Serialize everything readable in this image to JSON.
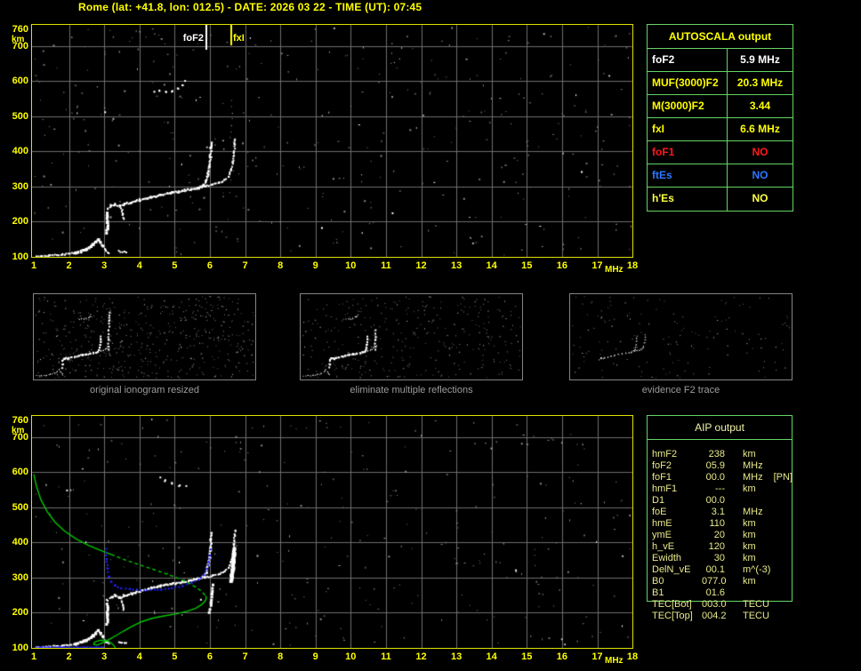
{
  "title": "Rome (lat: +41.8, lon: 012.5) - DATE: 2026 03 22 - TIME (UT): 07:45",
  "colors": {
    "background": "#000000",
    "accent_yellow": "#ffff00",
    "plot_border": "#e0e000",
    "grid": "#6e6e6e",
    "table_border": "#63d563",
    "trace_white": "#ffffff",
    "profile_green": "#00c800",
    "model_blue": "#2222ff",
    "red": "#ff1a1a",
    "blue": "#2d77ff",
    "aip_text": "#e9e98c",
    "caption_gray": "#9c9c9c"
  },
  "autoscala": {
    "header": "AUTOSCALA output",
    "rows": [
      {
        "label": "foF2",
        "value": "5.9 MHz",
        "color": "#ffffff"
      },
      {
        "label": "MUF(3000)F2",
        "value": "20.3 MHz",
        "color": "#ffff00"
      },
      {
        "label": "M(3000)F2",
        "value": "3.44",
        "color": "#ffff00"
      },
      {
        "label": "fxI",
        "value": "6.6 MHz",
        "color": "#ffff00"
      },
      {
        "label": "foF1",
        "value": "NO",
        "color": "#ff1a1a"
      },
      {
        "label": "ftEs",
        "value": "NO",
        "color": "#2d77ff"
      },
      {
        "label": "h'Es",
        "value": "NO",
        "color": "#ffff44"
      }
    ]
  },
  "aip": {
    "header": "AIP output",
    "rows": [
      {
        "label": "hmF2",
        "value": "238",
        "unit": "km",
        "note": ""
      },
      {
        "label": "foF2",
        "value": "05.9",
        "unit": "MHz",
        "note": ""
      },
      {
        "label": "foF1",
        "value": "00.0",
        "unit": "MHz",
        "note": "[PN]"
      },
      {
        "label": "hmF1",
        "value": "---",
        "unit": "km",
        "note": ""
      },
      {
        "label": "D1",
        "value": "00.0",
        "unit": "",
        "note": ""
      },
      {
        "label": "foE",
        "value": "3.1",
        "unit": "MHz",
        "note": ""
      },
      {
        "label": "hmE",
        "value": "110",
        "unit": "km",
        "note": ""
      },
      {
        "label": "ymE",
        "value": "20",
        "unit": "km",
        "note": ""
      },
      {
        "label": "h_vE",
        "value": "120",
        "unit": "km",
        "note": ""
      },
      {
        "label": "Ewidth",
        "value": "30",
        "unit": "km",
        "note": ""
      },
      {
        "label": "DelN_vE",
        "value": "00.1",
        "unit": "m^(-3)",
        "note": ""
      },
      {
        "label": "B0",
        "value": "077.0",
        "unit": "km",
        "note": ""
      },
      {
        "label": "B1",
        "value": "01.6",
        "unit": "",
        "note": ""
      },
      {
        "label": "TEC[Bot]",
        "value": "003.0",
        "unit": "TECU",
        "note": ""
      },
      {
        "label": "TEC[Top]",
        "value": "004.2",
        "unit": "TECU",
        "note": ""
      }
    ]
  },
  "thumbnails": [
    {
      "caption": "original ionogram resized"
    },
    {
      "caption": "eliminate multiple reflections"
    },
    {
      "caption": "evidence F2 trace"
    }
  ],
  "chart_data": {
    "type": "scatter",
    "x_axis": {
      "label": "MHz",
      "range": [
        1,
        18
      ],
      "ticks": [
        "1",
        "2",
        "3",
        "4",
        "5",
        "6",
        "7",
        "8",
        "9",
        "10",
        "11",
        "12",
        "13",
        "14",
        "15",
        "16",
        "17",
        "18"
      ]
    },
    "y_axis": {
      "label": "km",
      "range": [
        100,
        760
      ],
      "ticks": [
        "760",
        "700",
        "600",
        "500",
        "400",
        "300",
        "200",
        "100"
      ]
    },
    "markers": {
      "foF2": {
        "label": "foF2",
        "freq": 5.9,
        "color": "#ffffff"
      },
      "fxI": {
        "label": "fxI",
        "freq": 6.6,
        "color": "#ffff00"
      }
    },
    "traces": {
      "e_layer": [
        [
          1.05,
          104
        ],
        [
          1.4,
          106
        ],
        [
          1.8,
          109
        ],
        [
          2.15,
          114
        ],
        [
          2.45,
          124
        ],
        [
          2.65,
          138
        ],
        [
          2.8,
          152
        ],
        [
          2.92,
          136
        ],
        [
          3.02,
          120
        ],
        [
          3.1,
          113
        ]
      ],
      "e_tail": [
        [
          3.38,
          118
        ],
        [
          3.6,
          115
        ]
      ],
      "cusp_cluster": [
        [
          3.04,
          172
        ],
        [
          3.06,
          200
        ],
        [
          3.05,
          228
        ]
      ],
      "f_trace": [
        [
          3.07,
          238
        ],
        [
          3.18,
          248
        ],
        [
          3.3,
          251
        ],
        [
          3.42,
          246
        ],
        [
          3.55,
          251
        ],
        [
          3.75,
          257
        ],
        [
          4.0,
          264
        ],
        [
          4.3,
          272
        ],
        [
          4.6,
          279
        ],
        [
          4.9,
          285
        ],
        [
          5.2,
          290
        ],
        [
          5.45,
          294
        ],
        [
          5.65,
          299
        ],
        [
          5.8,
          306
        ],
        [
          5.88,
          318
        ],
        [
          5.93,
          338
        ],
        [
          5.96,
          360
        ],
        [
          5.99,
          385
        ],
        [
          6.01,
          410
        ],
        [
          6.02,
          428
        ]
      ],
      "f_spur": [
        [
          3.46,
          242
        ],
        [
          3.5,
          226
        ],
        [
          3.53,
          210
        ]
      ],
      "x_trace": [
        [
          5.62,
          297
        ],
        [
          5.85,
          303
        ],
        [
          6.05,
          308
        ],
        [
          6.25,
          313
        ],
        [
          6.4,
          320
        ],
        [
          6.5,
          331
        ],
        [
          6.58,
          348
        ],
        [
          6.63,
          372
        ],
        [
          6.66,
          398
        ],
        [
          6.68,
          422
        ],
        [
          6.69,
          438
        ]
      ],
      "x_streak": [
        [
          6.55,
          295
        ],
        [
          6.6,
          325
        ],
        [
          6.63,
          355
        ],
        [
          6.65,
          385
        ]
      ],
      "o_blob": [
        [
          5.96,
          205
        ],
        [
          5.99,
          232
        ],
        [
          6.02,
          258
        ],
        [
          6.05,
          282
        ]
      ],
      "multiples_top": [
        [
          4.38,
          570
        ],
        [
          4.55,
          574
        ],
        [
          4.72,
          570
        ],
        [
          4.9,
          574
        ],
        [
          5.08,
          583
        ],
        [
          5.2,
          592
        ],
        [
          5.27,
          604
        ]
      ],
      "multiples_bottom": [
        [
          4.55,
          588
        ],
        [
          4.7,
          578
        ],
        [
          4.9,
          570
        ],
        [
          5.1,
          565
        ],
        [
          5.3,
          562
        ]
      ],
      "multiples_faint": [
        [
          6.58,
          440
        ],
        [
          6.6,
          475
        ],
        [
          6.62,
          510
        ],
        [
          6.6,
          545
        ]
      ]
    },
    "profile_green": {
      "solid_top": [
        [
          1.0,
          594
        ],
        [
          1.08,
          558
        ],
        [
          1.2,
          522
        ],
        [
          1.38,
          488
        ],
        [
          1.6,
          458
        ],
        [
          1.88,
          432
        ],
        [
          2.2,
          410
        ],
        [
          2.55,
          392
        ],
        [
          2.9,
          377
        ],
        [
          3.2,
          366
        ]
      ],
      "dashed_mid": [
        [
          3.2,
          366
        ],
        [
          3.55,
          352
        ],
        [
          3.95,
          338
        ],
        [
          4.35,
          325
        ],
        [
          4.75,
          311
        ],
        [
          5.1,
          298
        ],
        [
          5.4,
          284
        ],
        [
          5.65,
          270
        ],
        [
          5.8,
          257
        ],
        [
          5.88,
          248
        ]
      ],
      "solid_return": [
        [
          5.88,
          248
        ],
        [
          5.9,
          242
        ],
        [
          5.87,
          234
        ],
        [
          5.78,
          224
        ],
        [
          5.6,
          213
        ],
        [
          5.35,
          204
        ],
        [
          5.05,
          197
        ],
        [
          4.7,
          191
        ],
        [
          4.35,
          184
        ],
        [
          4.05,
          174
        ],
        [
          3.78,
          161
        ],
        [
          3.55,
          148
        ],
        [
          3.35,
          136
        ],
        [
          3.18,
          126
        ],
        [
          3.05,
          120
        ]
      ],
      "e_loop": [
        [
          3.05,
          120
        ],
        [
          2.92,
          113
        ],
        [
          2.8,
          108
        ],
        [
          2.7,
          110
        ],
        [
          2.72,
          116
        ],
        [
          2.85,
          121
        ],
        [
          3.0,
          122
        ],
        [
          3.13,
          118
        ],
        [
          3.23,
          111
        ],
        [
          3.29,
          104
        ],
        [
          3.31,
          100
        ]
      ]
    },
    "model_trace_blue": {
      "e_row": [
        [
          1.02,
          104
        ],
        [
          2.95,
          104
        ]
      ],
      "f_model": [
        [
          3.02,
          385
        ],
        [
          3.04,
          355
        ],
        [
          3.07,
          328
        ],
        [
          3.11,
          306
        ],
        [
          3.17,
          290
        ],
        [
          3.28,
          280
        ],
        [
          3.45,
          273
        ],
        [
          3.7,
          269
        ],
        [
          4.0,
          267
        ],
        [
          4.3,
          267
        ],
        [
          4.6,
          269
        ],
        [
          4.9,
          273
        ],
        [
          5.2,
          279
        ],
        [
          5.45,
          287
        ],
        [
          5.65,
          297
        ],
        [
          5.8,
          310
        ],
        [
          5.89,
          327
        ],
        [
          5.94,
          347
        ],
        [
          5.97,
          366
        ],
        [
          5.99,
          382
        ]
      ]
    }
  }
}
